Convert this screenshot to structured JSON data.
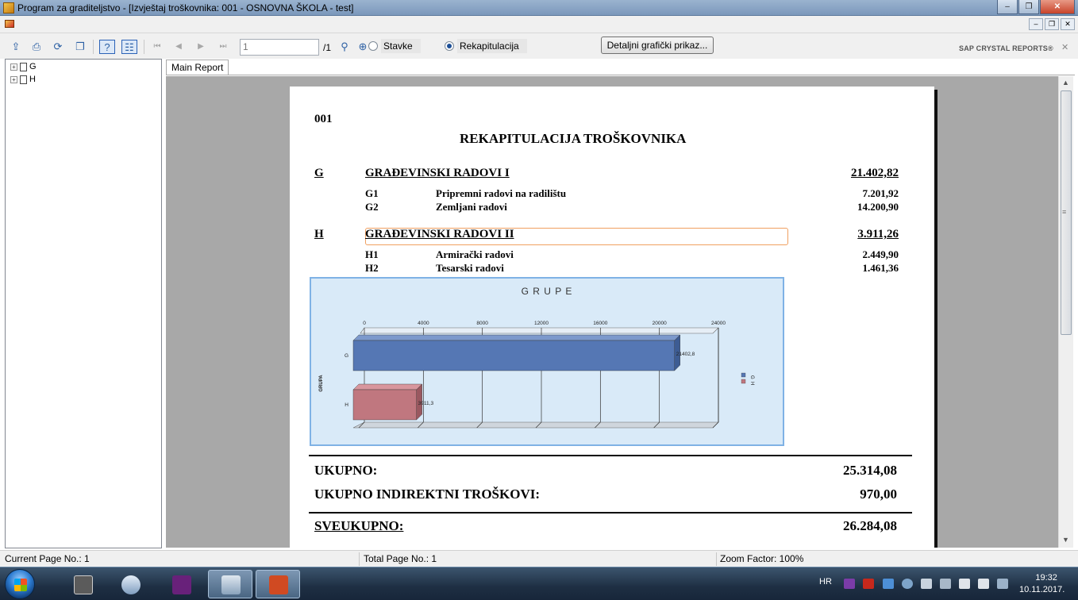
{
  "window": {
    "title": "Program za graditeljstvo - [Izvještaj troškovnika: 001 - OSNOVNA ŠKOLA - test]",
    "minimize_glyph": "–",
    "maximize_glyph": "❐",
    "close_glyph": "✕"
  },
  "mdi": {
    "minimize_glyph": "–",
    "restore_glyph": "❐",
    "close_glyph": "✕"
  },
  "toolbar": {
    "icons": [
      "export-icon",
      "print-icon",
      "refresh-icon",
      "copy-icon",
      "help-icon",
      "group-tree-toggle-icon",
      "first-page-icon",
      "previous-page-icon",
      "next-page-icon",
      "last-page-icon",
      "search-icon",
      "zoom-icon"
    ],
    "page_value": "1",
    "page_total": "/1",
    "radio_stavke": "Stavke",
    "radio_rekapitulacija": "Rekapitulacija",
    "selected_mode": "Rekapitulacija",
    "detail_button": "Detaljni grafički prikaz...",
    "brand": "SAP CRYSTAL REPORTS®",
    "brand_close": "✕"
  },
  "group_tree": {
    "expander": "+",
    "items": [
      {
        "label": "G"
      },
      {
        "label": "H"
      }
    ]
  },
  "tabs": [
    {
      "label": "Main Report"
    }
  ],
  "report": {
    "number": "001",
    "title": "REKAPITULACIJA TROŠKOVNIKA",
    "groups": [
      {
        "code": "G",
        "name": "GRAĐEVINSKI RADOVI I",
        "total": "21.402,82",
        "items": [
          {
            "code": "G1",
            "name": "Pripremni radovi na radilištu",
            "amount": "7.201,92"
          },
          {
            "code": "G2",
            "name": "Zemljani radovi",
            "amount": "14.200,90"
          }
        ]
      },
      {
        "code": "H",
        "name": "GRAĐEVINSKI RADOVI II",
        "total": "3.911,26",
        "items": [
          {
            "code": "H1",
            "name": "Armirački radovi",
            "amount": "2.449,90"
          },
          {
            "code": "H2",
            "name": "Tesarski radovi",
            "amount": "1.461,36"
          }
        ]
      }
    ],
    "summary": {
      "ukupno_label": "UKUPNO:",
      "ukupno_value": "25.314,08",
      "indirektni_label": "UKUPNO INDIREKTNI TROŠKOVI:",
      "indirektni_value": "970,00",
      "sveukupno_label": "SVEUKUPNO:",
      "sveukupno_value": "26.284,08"
    }
  },
  "chart_data": {
    "type": "bar",
    "orientation": "horizontal",
    "title": "G R U P E",
    "xlabel": "",
    "ylabel": "GRUPA",
    "categories": [
      "G",
      "H"
    ],
    "values": [
      21402.8,
      3911.3
    ],
    "data_labels": [
      "21402,8",
      "3911,3"
    ],
    "xlim": [
      0,
      24000
    ],
    "xticks": [
      0,
      4000,
      8000,
      12000,
      16000,
      20000,
      24000
    ],
    "grid": true,
    "legend": {
      "entries": [
        "G",
        "H"
      ],
      "placement": "right"
    },
    "colors": [
      "#5577b4",
      "#c0777f"
    ]
  },
  "status": {
    "current_page": "Current Page No.: 1",
    "total_page": "Total Page No.: 1",
    "zoom": "Zoom Factor: 100%"
  },
  "taskbar": {
    "apps": [
      "Start",
      "Document viewer",
      "Windows Explorer",
      "Visual Studio",
      "Program za graditeljstvo",
      "PowerPoint"
    ],
    "language": "HR",
    "time": "19:32",
    "date": "10.11.2017."
  }
}
